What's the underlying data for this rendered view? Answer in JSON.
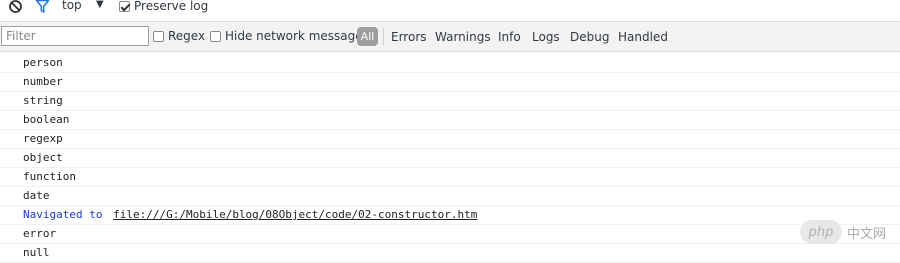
{
  "top_toolbar": {
    "context": "top",
    "dropdown_glyph": "▼",
    "preserve_log_label": "Preserve log",
    "preserve_log_checked": true,
    "icons": [
      "clear-icon",
      "filter-icon"
    ]
  },
  "filter_bar": {
    "filter_placeholder": "Filter",
    "filter_value": "",
    "regex_label": "Regex",
    "regex_checked": false,
    "hide_network_label": "Hide network messages",
    "hide_network_checked": false,
    "levels": {
      "all": "All",
      "errors": "Errors",
      "warnings": "Warnings",
      "info": "Info",
      "logs": "Logs",
      "debug": "Debug",
      "handled": "Handled"
    },
    "active_level": "All"
  },
  "console": {
    "lines": [
      {
        "text": "person"
      },
      {
        "text": "number"
      },
      {
        "text": "string"
      },
      {
        "text": "boolean"
      },
      {
        "text": "regexp"
      },
      {
        "text": "object"
      },
      {
        "text": "function"
      },
      {
        "text": "date"
      },
      {
        "prefix": "Navigated to",
        "link": "file:///G:/Mobile/blog/08Object/code/02-constructor.htm"
      },
      {
        "text": "error"
      },
      {
        "text": "null"
      }
    ]
  },
  "watermark": {
    "badge": "php",
    "text": "中文网"
  },
  "colors": {
    "toolbar_bg": "#f3f3f3",
    "all_button_bg": "#9e9e9e",
    "navigated_text": "#1a3bd6"
  }
}
